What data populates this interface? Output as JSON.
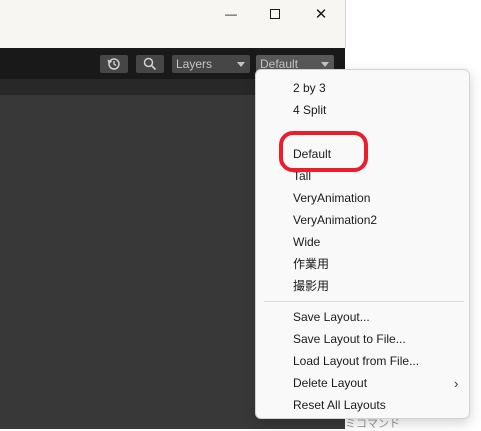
{
  "window": {
    "minimize_glyph": "—",
    "maximize_glyph": "☐",
    "close_glyph": "✕"
  },
  "toolbar": {
    "history_icon": "history-icon",
    "search_icon": "search-icon",
    "layers_label": "Layers",
    "layout_label": "Default"
  },
  "menu": {
    "items": [
      {
        "label": "2 by 3"
      },
      {
        "label": "4 Split"
      },
      {
        "label": "Default"
      },
      {
        "label": "Tall"
      },
      {
        "label": "VeryAnimation"
      },
      {
        "label": "VeryAnimation2"
      },
      {
        "label": "Wide"
      },
      {
        "label": "作業用"
      },
      {
        "label": "撮影用"
      }
    ],
    "actions": [
      {
        "label": "Save Layout..."
      },
      {
        "label": "Save Layout to File..."
      },
      {
        "label": "Load Layout from File..."
      },
      {
        "label": "Delete Layout",
        "has_submenu": true
      },
      {
        "label": "Reset All Layouts"
      }
    ],
    "submenu_arrow": "›"
  },
  "background_text": "ミコマンド",
  "colors": {
    "highlight": "#ec1c2a",
    "editor_bg": "#383838",
    "toolbar_bg": "#191919"
  }
}
